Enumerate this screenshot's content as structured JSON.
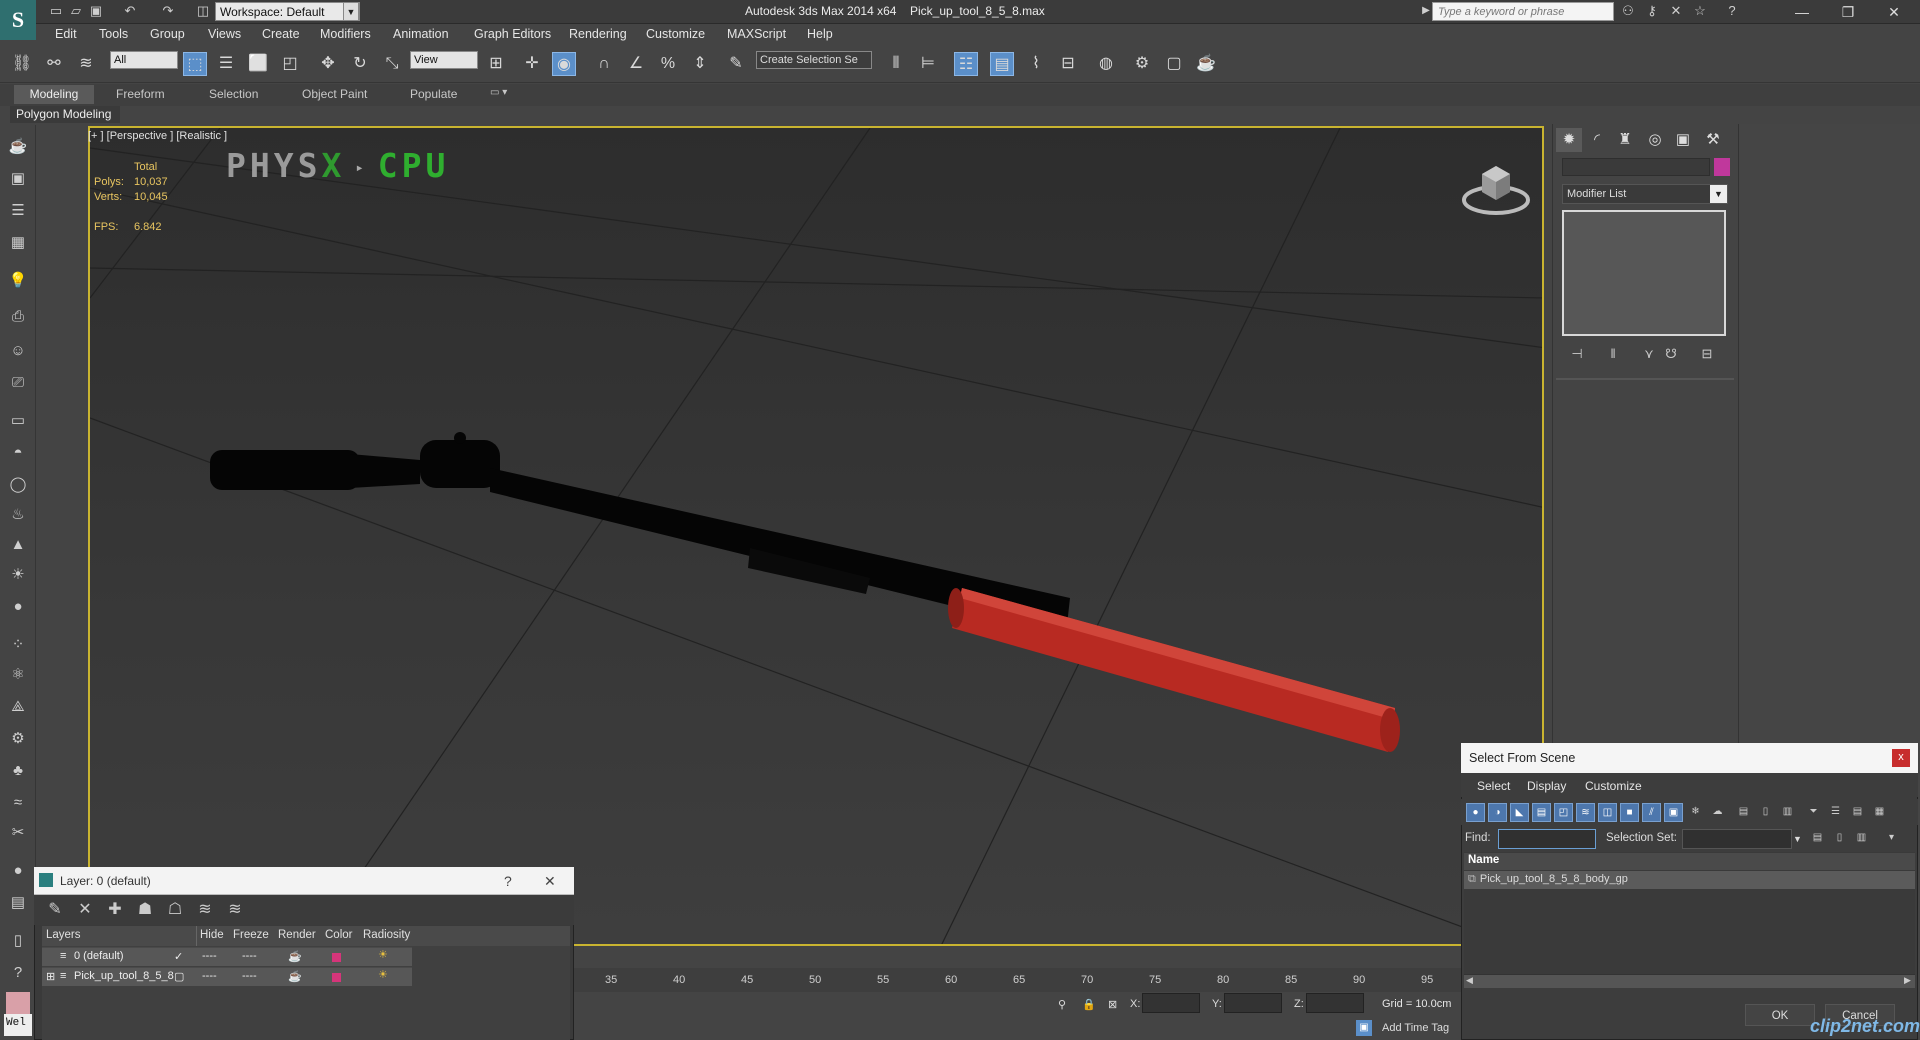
{
  "app": {
    "title": "Autodesk 3ds Max  2014 x64",
    "file": "Pick_up_tool_8_5_8.max",
    "logo": "S",
    "workspace": "Workspace: Default",
    "search_placeholder": "Type a keyword or phrase"
  },
  "menus": [
    "Edit",
    "Tools",
    "Group",
    "Views",
    "Create",
    "Modifiers",
    "Animation",
    "Graph Editors",
    "Rendering",
    "Customize",
    "MAXScript",
    "Help"
  ],
  "toolbar": {
    "filter_value": "All",
    "refcoord_value": "View",
    "selection_set_value": "Create Selection Se"
  },
  "ribbon": {
    "tabs": [
      "Modeling",
      "Freeform",
      "Selection",
      "Object Paint",
      "Populate"
    ],
    "panel": "Polygon Modeling"
  },
  "viewport": {
    "label": "[+ ] [Perspective ] [Realistic ]",
    "stats_header": "Total",
    "polys_label": "Polys:",
    "polys_value": "10,037",
    "verts_label": "Verts:",
    "verts_value": "10,045",
    "fps_label": "FPS:",
    "fps_value": "6.842",
    "physx_a": "PHYS",
    "physx_b": "X",
    "physx_c": "CPU",
    "handle_color": "#b82a22"
  },
  "command_panel": {
    "modifier_list": "Modifier List",
    "object_color": "#c0389c"
  },
  "layer_window": {
    "title": "Layer: 0 (default)",
    "help": "?",
    "close": "✕",
    "columns": [
      "Layers",
      "Hide",
      "Freeze",
      "Render",
      "Color",
      "Radiosity"
    ],
    "rows": [
      {
        "name": "0 (default)",
        "hide": "----",
        "freeze": "----",
        "color": "#d5357a"
      },
      {
        "name": "Pick_up_tool_8_5_8",
        "hide": "----",
        "freeze": "----",
        "color": "#d5357a"
      }
    ]
  },
  "timeline": {
    "ticks": [
      "35",
      "40",
      "45",
      "50",
      "55",
      "60",
      "65",
      "70",
      "75",
      "80",
      "85",
      "90",
      "95"
    ]
  },
  "status": {
    "x_label": "X:",
    "y_label": "Y:",
    "z_label": "Z:",
    "grid": "Grid = 10.0cm",
    "add_time_tag": "Add Time Tag",
    "welcome": "Wel"
  },
  "select_from_scene": {
    "title": "Select From Scene",
    "close": "x",
    "menus": [
      "Select",
      "Display",
      "Customize"
    ],
    "find_label": "Find:",
    "selection_set_label": "Selection Set:",
    "column_name": "Name",
    "item": "Pick_up_tool_8_5_8_body_gp",
    "ok": "OK",
    "cancel": "Cancel"
  },
  "watermark": "clip2net.com"
}
